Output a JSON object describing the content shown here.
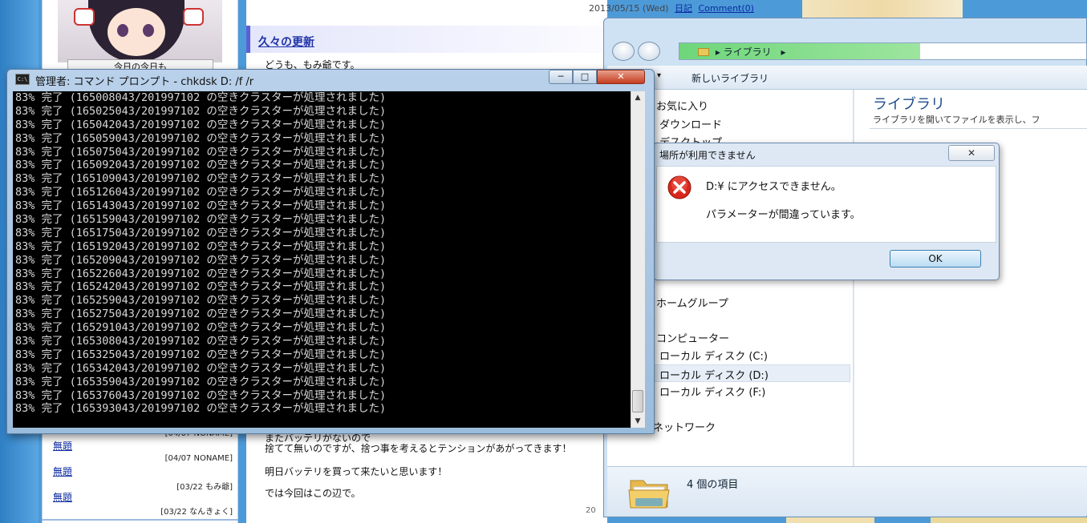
{
  "blog": {
    "sidebar_box_text": "今日の今日も",
    "sidebar_links": [
      {
        "label": "無題",
        "meta": "[04/07 NONAME]"
      },
      {
        "label": "無題",
        "meta": "[04/07 NONAME]"
      },
      {
        "label": "無題",
        "meta": "[03/22 もみ爺]"
      },
      {
        "label": "無題",
        "meta": "[03/22 なんきょく]"
      }
    ],
    "post_date": "2013/05/15 (Wed)",
    "post_category": "日記",
    "post_comment": "Comment(0)",
    "post_title": "久々の更新",
    "post_lines": [
      "どうも、もみ爺です。",
      "またバッテリがないので",
      "捨てて無いのですが、捨つ事を考えるとテンションがあがってきます！",
      "明日バッテリを買って来たいと思います！",
      "では今回はこの辺で。"
    ],
    "post_footer": "20"
  },
  "explorer": {
    "address_segments": [
      "ライブラリ",
      "▸"
    ],
    "toolbar_new_library": "新しいライブラリ",
    "toolbar_arrow": "▾",
    "nav_items": {
      "favorites": "お気に入り",
      "download": "ダウンロード",
      "desktop": "デスクトップ",
      "homegroup": "ホームグループ",
      "computer": "コンピューター",
      "disk_c": "ローカル ディスク (C:)",
      "disk_d": "ローカル ディスク (D:)",
      "disk_f": "ローカル ディスク (F:)",
      "network": "ネットワーク"
    },
    "library_title": "ライブラリ",
    "library_subtitle": "ライブラリを開いてファイルを表示し、フ",
    "status_count": "4 個の項目"
  },
  "error_dialog": {
    "title": "場所が利用できません",
    "close_label": "✕",
    "message_line1": "D:¥ にアクセスできません。",
    "message_line2": "パラメーターが間違っています。",
    "ok_label": "OK",
    "icon": "error-x-icon"
  },
  "cmd": {
    "icon_text": "C:\\",
    "title": "管理者: コマンド プロンプト - chkdsk  D: /f /r",
    "min_label": "─",
    "max_label": "□",
    "close_label": "✕",
    "scroll_up": "▲",
    "scroll_down": "▼",
    "lines": [
      "83% 完了 (165008043/201997102 の空きクラスターが処理されました)",
      "83% 完了 (165025043/201997102 の空きクラスターが処理されました)",
      "83% 完了 (165042043/201997102 の空きクラスターが処理されました)",
      "83% 完了 (165059043/201997102 の空きクラスターが処理されました)",
      "83% 完了 (165075043/201997102 の空きクラスターが処理されました)",
      "83% 完了 (165092043/201997102 の空きクラスターが処理されました)",
      "83% 完了 (165109043/201997102 の空きクラスターが処理されました)",
      "83% 完了 (165126043/201997102 の空きクラスターが処理されました)",
      "83% 完了 (165143043/201997102 の空きクラスターが処理されました)",
      "83% 完了 (165159043/201997102 の空きクラスターが処理されました)",
      "83% 完了 (165175043/201997102 の空きクラスターが処理されました)",
      "83% 完了 (165192043/201997102 の空きクラスターが処理されました)",
      "83% 完了 (165209043/201997102 の空きクラスターが処理されました)",
      "83% 完了 (165226043/201997102 の空きクラスターが処理されました)",
      "83% 完了 (165242043/201997102 の空きクラスターが処理されました)",
      "83% 完了 (165259043/201997102 の空きクラスターが処理されました)",
      "83% 完了 (165275043/201997102 の空きクラスターが処理されました)",
      "83% 完了 (165291043/201997102 の空きクラスターが処理されました)",
      "83% 完了 (165308043/201997102 の空きクラスターが処理されました)",
      "83% 完了 (165325043/201997102 の空きクラスターが処理されました)",
      "83% 完了 (165342043/201997102 の空きクラスターが処理されました)",
      "83% 完了 (165359043/201997102 の空きクラスターが処理されました)",
      "83% 完了 (165376043/201997102 の空きクラスターが処理されました)",
      "83% 完了 (165393043/201997102 の空きクラスターが処理されました)"
    ]
  },
  "colors": {
    "cmd_background": "#000000",
    "cmd_text": "#d8d8d8",
    "dialog_error_red": "#d9271c",
    "address_bar_green": "#6fd67a",
    "blog_title_accent": "#5c5fd8"
  }
}
